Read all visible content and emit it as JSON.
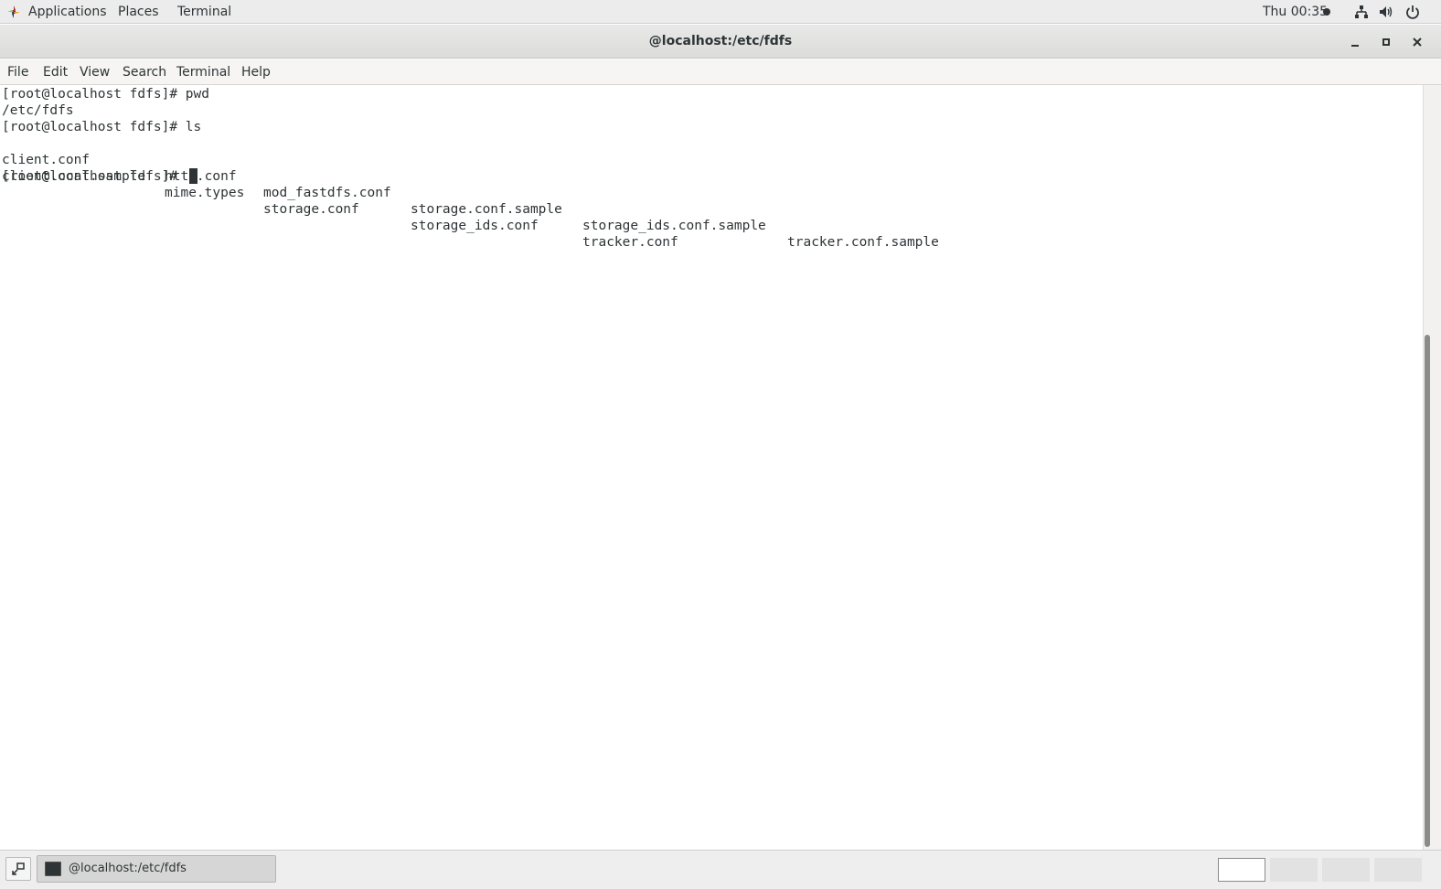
{
  "top_panel": {
    "applications_label": "Applications",
    "places_label": "Places",
    "terminal_label": "Terminal",
    "clock": "Thu 00:35"
  },
  "window": {
    "title": "@localhost:/etc/fdfs"
  },
  "menubar": {
    "file": "File",
    "edit": "Edit",
    "view": "View",
    "search": "Search",
    "terminal": "Terminal",
    "help": "Help"
  },
  "terminal": {
    "lines": [
      "[root@localhost fdfs]# pwd",
      "/etc/fdfs",
      "[root@localhost fdfs]# ls"
    ],
    "ls_rows": [
      [
        "client.conf",
        "http.conf",
        "mod_fastdfs.conf",
        "storage.conf.sample",
        "storage_ids.conf.sample",
        "tracker.conf.sample"
      ],
      [
        "client.conf.sample",
        "mime.types",
        "storage.conf",
        "storage_ids.conf",
        "tracker.conf",
        ""
      ]
    ],
    "prompt": "[root@localhost fdfs]# "
  },
  "taskbar": {
    "task_label": "@localhost:/etc/fdfs",
    "workspace_count": 4,
    "active_workspace": 1
  },
  "colors": {
    "panel_bg": "#ececec",
    "terminal_bg": "#ffffff",
    "terminal_fg": "#2e3436"
  }
}
